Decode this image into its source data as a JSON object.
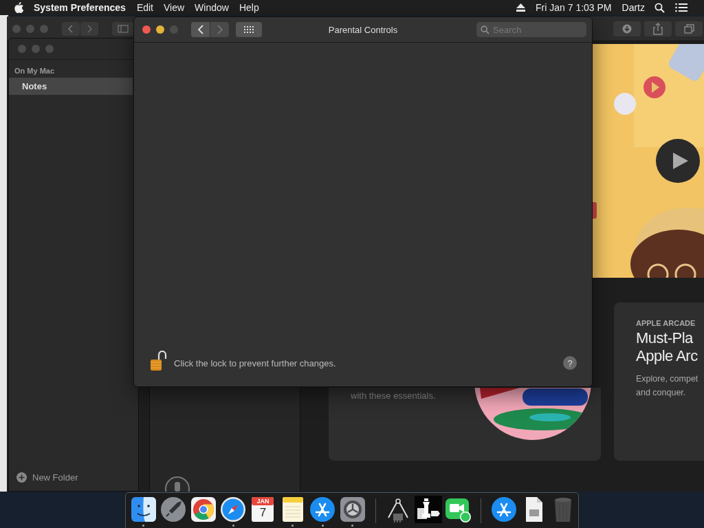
{
  "menu_bar": {
    "app_name": "System Preferences",
    "menus": [
      "Edit",
      "View",
      "Window",
      "Help"
    ],
    "clock": "Fri Jan 7  1:03 PM",
    "user": "Dartz"
  },
  "app_store_window": {
    "cards": [
      {
        "kind": "feature",
        "text": "with these essentials."
      },
      {
        "kind": "arcade",
        "eyebrow": "APPLE ARCADE",
        "title_lines": [
          "Must-Pla",
          "Apple Arc"
        ],
        "text_lines": [
          "Explore, compet",
          "and conquer."
        ]
      }
    ]
  },
  "notes_window": {
    "section": "On My Mac",
    "folders": [
      {
        "label": "Notes",
        "selected": true
      }
    ],
    "new_folder": "New Folder"
  },
  "preferences_window": {
    "title": "Parental Controls",
    "search": {
      "placeholder": "Search"
    },
    "locked": false,
    "lock_message": "Click the lock to prevent further changes.",
    "help": "?"
  },
  "dock": {
    "items": [
      {
        "kind": "finder",
        "running": true
      },
      {
        "kind": "launchpad",
        "running": false
      },
      {
        "kind": "chrome",
        "running": false
      },
      {
        "kind": "safari",
        "running": true
      },
      {
        "kind": "calendar",
        "running": false,
        "month": "JAN",
        "day": "7"
      },
      {
        "kind": "notes",
        "running": true
      },
      {
        "kind": "appstore",
        "running": true
      },
      {
        "kind": "preferences",
        "running": true
      },
      {
        "kind": "separator"
      },
      {
        "kind": "compass",
        "running": false
      },
      {
        "kind": "chess",
        "running": false
      },
      {
        "kind": "facetime",
        "running": false
      },
      {
        "kind": "separator"
      },
      {
        "kind": "appstore",
        "running": false
      },
      {
        "kind": "document",
        "running": false
      },
      {
        "kind": "trash",
        "running": false
      }
    ]
  }
}
